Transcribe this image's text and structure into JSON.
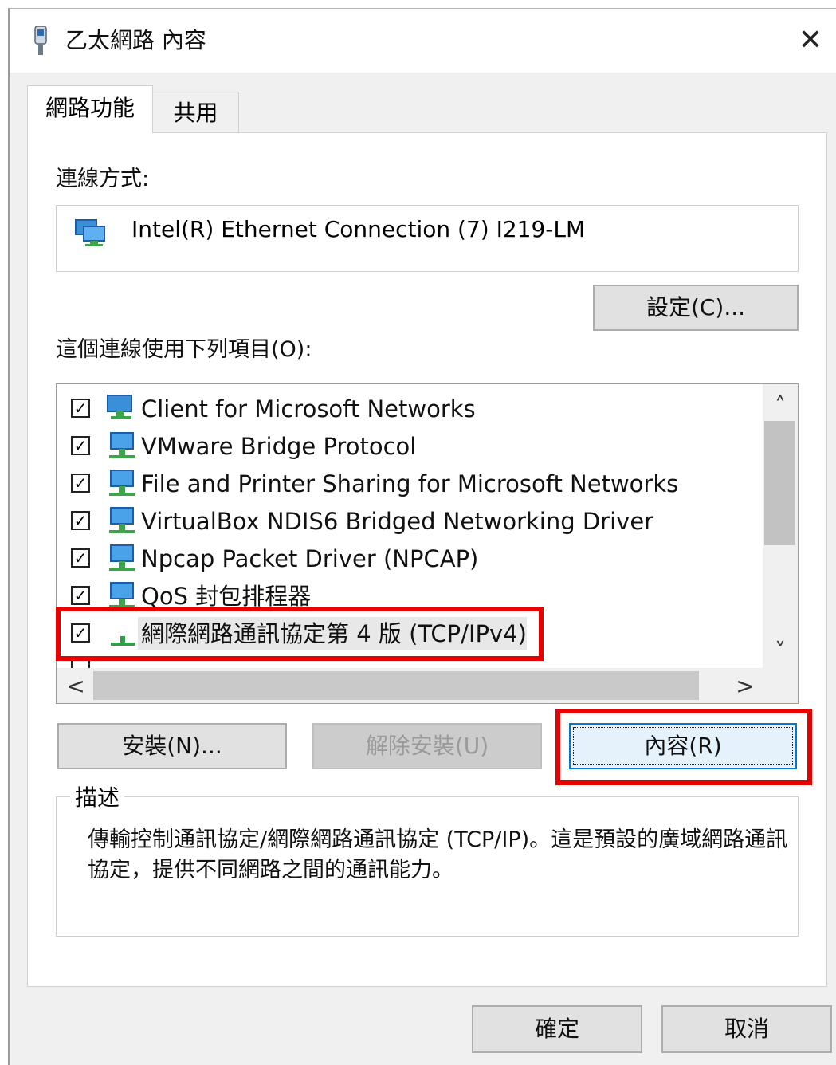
{
  "window": {
    "title": "乙太網路 內容",
    "close_glyph": "✕"
  },
  "tabs": [
    {
      "label": "網路功能",
      "active": true
    },
    {
      "label": "共用",
      "active": false
    }
  ],
  "connection": {
    "label": "連線方式:",
    "adapter_name": "Intel(R) Ethernet Connection (7) I219-LM",
    "configure_button": "設定(C)..."
  },
  "items_section": {
    "label": "這個連線使用下列項目(O):",
    "items": [
      {
        "label": "Client for Microsoft Networks",
        "checked": true,
        "icon": "network-client-icon"
      },
      {
        "label": "VMware Bridge Protocol",
        "checked": true,
        "icon": "network-protocol-icon"
      },
      {
        "label": "File and Printer Sharing for Microsoft Networks",
        "checked": true,
        "icon": "network-protocol-icon"
      },
      {
        "label": "VirtualBox NDIS6 Bridged Networking Driver",
        "checked": true,
        "icon": "network-protocol-icon"
      },
      {
        "label": "Npcap Packet Driver (NPCAP)",
        "checked": true,
        "icon": "network-protocol-icon"
      },
      {
        "label": "QoS 封包排程器",
        "checked": true,
        "icon": "network-protocol-icon"
      },
      {
        "label": "網際網路通訊協定第 4 版 (TCP/IPv4)",
        "checked": true,
        "selected": true,
        "icon": "network-protocol-green-icon"
      }
    ],
    "scroll_up": "˄",
    "scroll_down": "˅",
    "scroll_left": "<",
    "scroll_right": ">"
  },
  "actions": {
    "install": "安裝(N)...",
    "uninstall": "解除安裝(U)",
    "properties": "內容(R)"
  },
  "description": {
    "legend": "描述",
    "text": "傳輸控制通訊協定/網際網路通訊協定 (TCP/IP)。這是預設的廣域網路通訊協定，提供不同網路之間的通訊能力。"
  },
  "footer": {
    "ok": "確定",
    "cancel": "取消"
  },
  "colors": {
    "highlight_red": "#e60000",
    "focus_blue": "#0078d7",
    "dialog_bg": "#f0f0f0"
  }
}
